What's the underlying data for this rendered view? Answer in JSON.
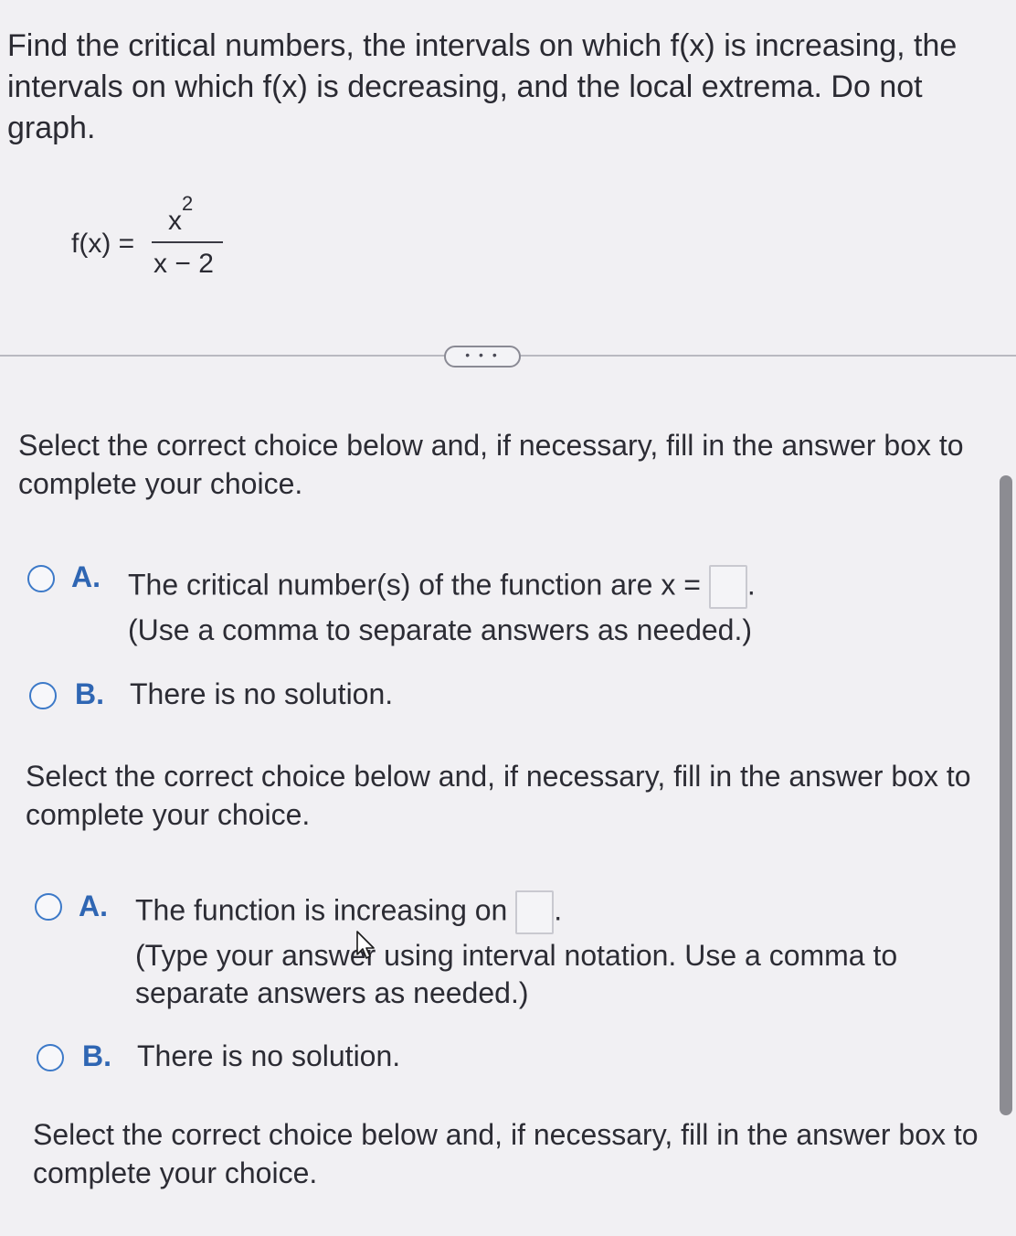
{
  "problem": {
    "prompt": "Find the critical numbers, the intervals on which f(x) is increasing, the intervals on which f(x) is decreasing, and the local extrema.  Do not graph.",
    "function_lhs": "f(x) =",
    "numerator_base": "x",
    "numerator_exponent": "2",
    "denominator": "x − 2"
  },
  "expand_button_label": "• • •",
  "part1": {
    "instruction": "Select the correct choice below and, if necessary, fill in the answer box to complete your choice.",
    "choice_a": {
      "letter": "A.",
      "text_before": "The critical number(s) of the function are x =",
      "text_after": ".",
      "answer_value": "",
      "note": "(Use a comma to separate answers as needed.)"
    },
    "choice_b": {
      "letter": "B.",
      "text": "There is no solution."
    }
  },
  "part2": {
    "instruction": "Select the correct choice below and, if necessary, fill in the answer box to complete your choice.",
    "choice_a": {
      "letter": "A.",
      "text_before": "The function is increasing on",
      "text_after": ".",
      "answer_value": "",
      "note_line1": "(Type your answer using interval notation. Use a comma to",
      "note_line2": "separate answers as needed.)"
    },
    "choice_b": {
      "letter": "B.",
      "text": "There is no solution."
    }
  },
  "part3": {
    "instruction": "Select the correct choice below and, if necessary, fill in the answer box to complete your choice."
  },
  "colors": {
    "accent": "#2f66b3",
    "radio_border": "#3c79c8",
    "text": "#2c2c34",
    "background": "#f1f0f3"
  }
}
